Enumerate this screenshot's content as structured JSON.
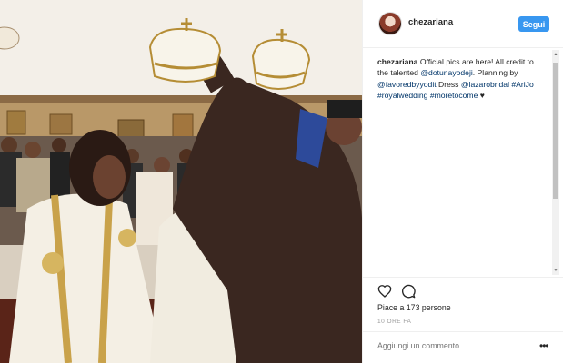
{
  "post": {
    "username": "chezariana",
    "follow_label": "Segui",
    "caption": {
      "author": "chezariana",
      "t1": " Official pics are here! All credit to the talented ",
      "m1": "@dotunayodeji",
      "t2": ". Planning by ",
      "m2": "@favoredbyyodit",
      "t3": " Dress ",
      "m3": "@lazarobridal",
      "t4": " ",
      "h1": "#AriJo",
      "t5": " ",
      "h2": "#royalwedding",
      "t6": " ",
      "h3": "#moretocome",
      "t7": " ♥"
    },
    "likes_text": "Piace a 173 persone",
    "time_text": "10 ORE FA",
    "comment_placeholder": "Aggiungi un commento...",
    "more_label": "•••"
  },
  "icons": {
    "heart": "heart-icon",
    "comment": "comment-icon",
    "avatar": "avatar"
  },
  "colors": {
    "follow_button": "#3897f0",
    "link": "#003569",
    "text": "#262626",
    "muted": "#999999"
  }
}
